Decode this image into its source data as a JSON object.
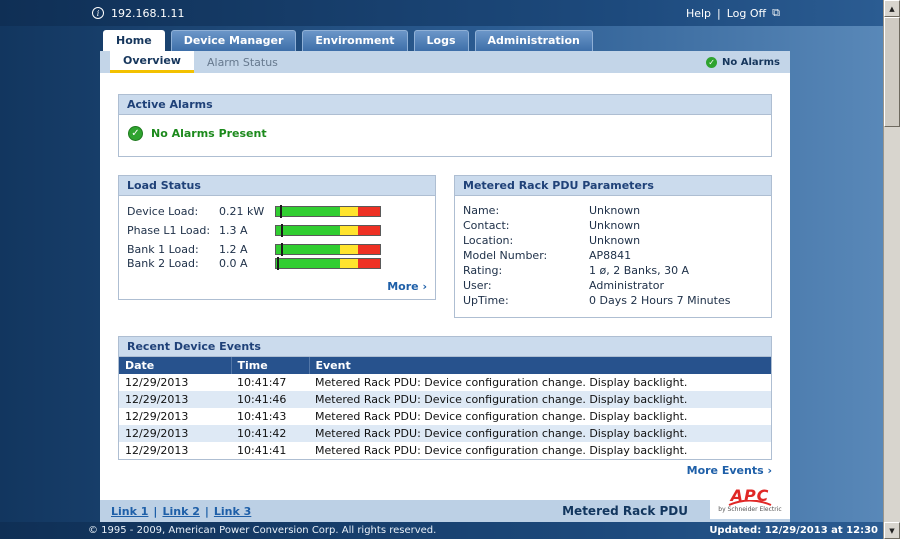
{
  "topbar": {
    "ip": "192.168.1.11",
    "help_label": "Help",
    "logoff_label": "Log Off",
    "separator": "|"
  },
  "tabs": [
    {
      "label": "Home",
      "active": true
    },
    {
      "label": "Device Manager",
      "active": false
    },
    {
      "label": "Environment",
      "active": false
    },
    {
      "label": "Logs",
      "active": false
    },
    {
      "label": "Administration",
      "active": false
    }
  ],
  "subnav": {
    "overview_label": "Overview",
    "alarm_status_label": "Alarm Status",
    "status_label": "No Alarms"
  },
  "active_alarms": {
    "title": "Active Alarms",
    "message": "No Alarms Present"
  },
  "load_status": {
    "title": "Load Status",
    "rows": [
      {
        "label": "Device Load:",
        "value": "0.21 kW",
        "marker_left": "4%"
      },
      {
        "label": "Phase L1 Load:",
        "value": "1.3 A",
        "marker_left": "5%"
      },
      {
        "label": "Bank 1 Load:",
        "value": "1.2 A",
        "marker_left": "5%"
      },
      {
        "label": "Bank 2 Load:",
        "value": "0.0 A",
        "marker_left": "1%"
      }
    ],
    "more_label": "More ›"
  },
  "pdu_params": {
    "title": "Metered Rack PDU Parameters",
    "rows": [
      {
        "label": "Name:",
        "value": "Unknown"
      },
      {
        "label": "Contact:",
        "value": "Unknown"
      },
      {
        "label": "Location:",
        "value": "Unknown"
      },
      {
        "label": "Model Number:",
        "value": "AP8841"
      },
      {
        "label": "Rating:",
        "value": "1 ø, 2 Banks, 30 A"
      },
      {
        "label": "User:",
        "value": "Administrator"
      },
      {
        "label": "UpTime:",
        "value": "0 Days 2 Hours 7 Minutes"
      }
    ]
  },
  "events": {
    "title": "Recent Device Events",
    "columns": [
      "Date",
      "Time",
      "Event"
    ],
    "rows": [
      {
        "date": "12/29/2013",
        "time": "10:41:47",
        "event": "Metered Rack PDU: Device configuration change. Display backlight."
      },
      {
        "date": "12/29/2013",
        "time": "10:41:46",
        "event": "Metered Rack PDU: Device configuration change. Display backlight."
      },
      {
        "date": "12/29/2013",
        "time": "10:41:43",
        "event": "Metered Rack PDU: Device configuration change. Display backlight."
      },
      {
        "date": "12/29/2013",
        "time": "10:41:42",
        "event": "Metered Rack PDU: Device configuration change. Display backlight."
      },
      {
        "date": "12/29/2013",
        "time": "10:41:41",
        "event": "Metered Rack PDU: Device configuration change. Display backlight."
      }
    ],
    "more_label": "More Events ›"
  },
  "footer": {
    "links": [
      "Link 1",
      "Link 2",
      "Link 3"
    ],
    "separator": "|",
    "product": "Metered Rack PDU",
    "logo_brand": "APC",
    "logo_sub": "by Schneider Electric"
  },
  "bottombar": {
    "copyright": "© 1995 - 2009, American Power Conversion Corp. All rights reserved.",
    "updated": "Updated: 12/29/2013 at 12:30"
  },
  "icons": {
    "info": "i",
    "logoff": "⧉",
    "check": "✓",
    "scroll_up": "▲",
    "scroll_down": "▼"
  },
  "colors": {
    "accent_navy": "#1F4178",
    "tab_blue": "#4A7CB8",
    "header_bg": "#CBDBED",
    "table_header_bg": "#27528D",
    "alt_row": "#DEE9F5",
    "link_blue": "#1E5FA8",
    "ok_green": "#2FA32F",
    "bar_green": "#31CE31",
    "bar_yellow": "#FFE42E",
    "bar_red": "#EE3124",
    "apc_red": "#E02826"
  }
}
